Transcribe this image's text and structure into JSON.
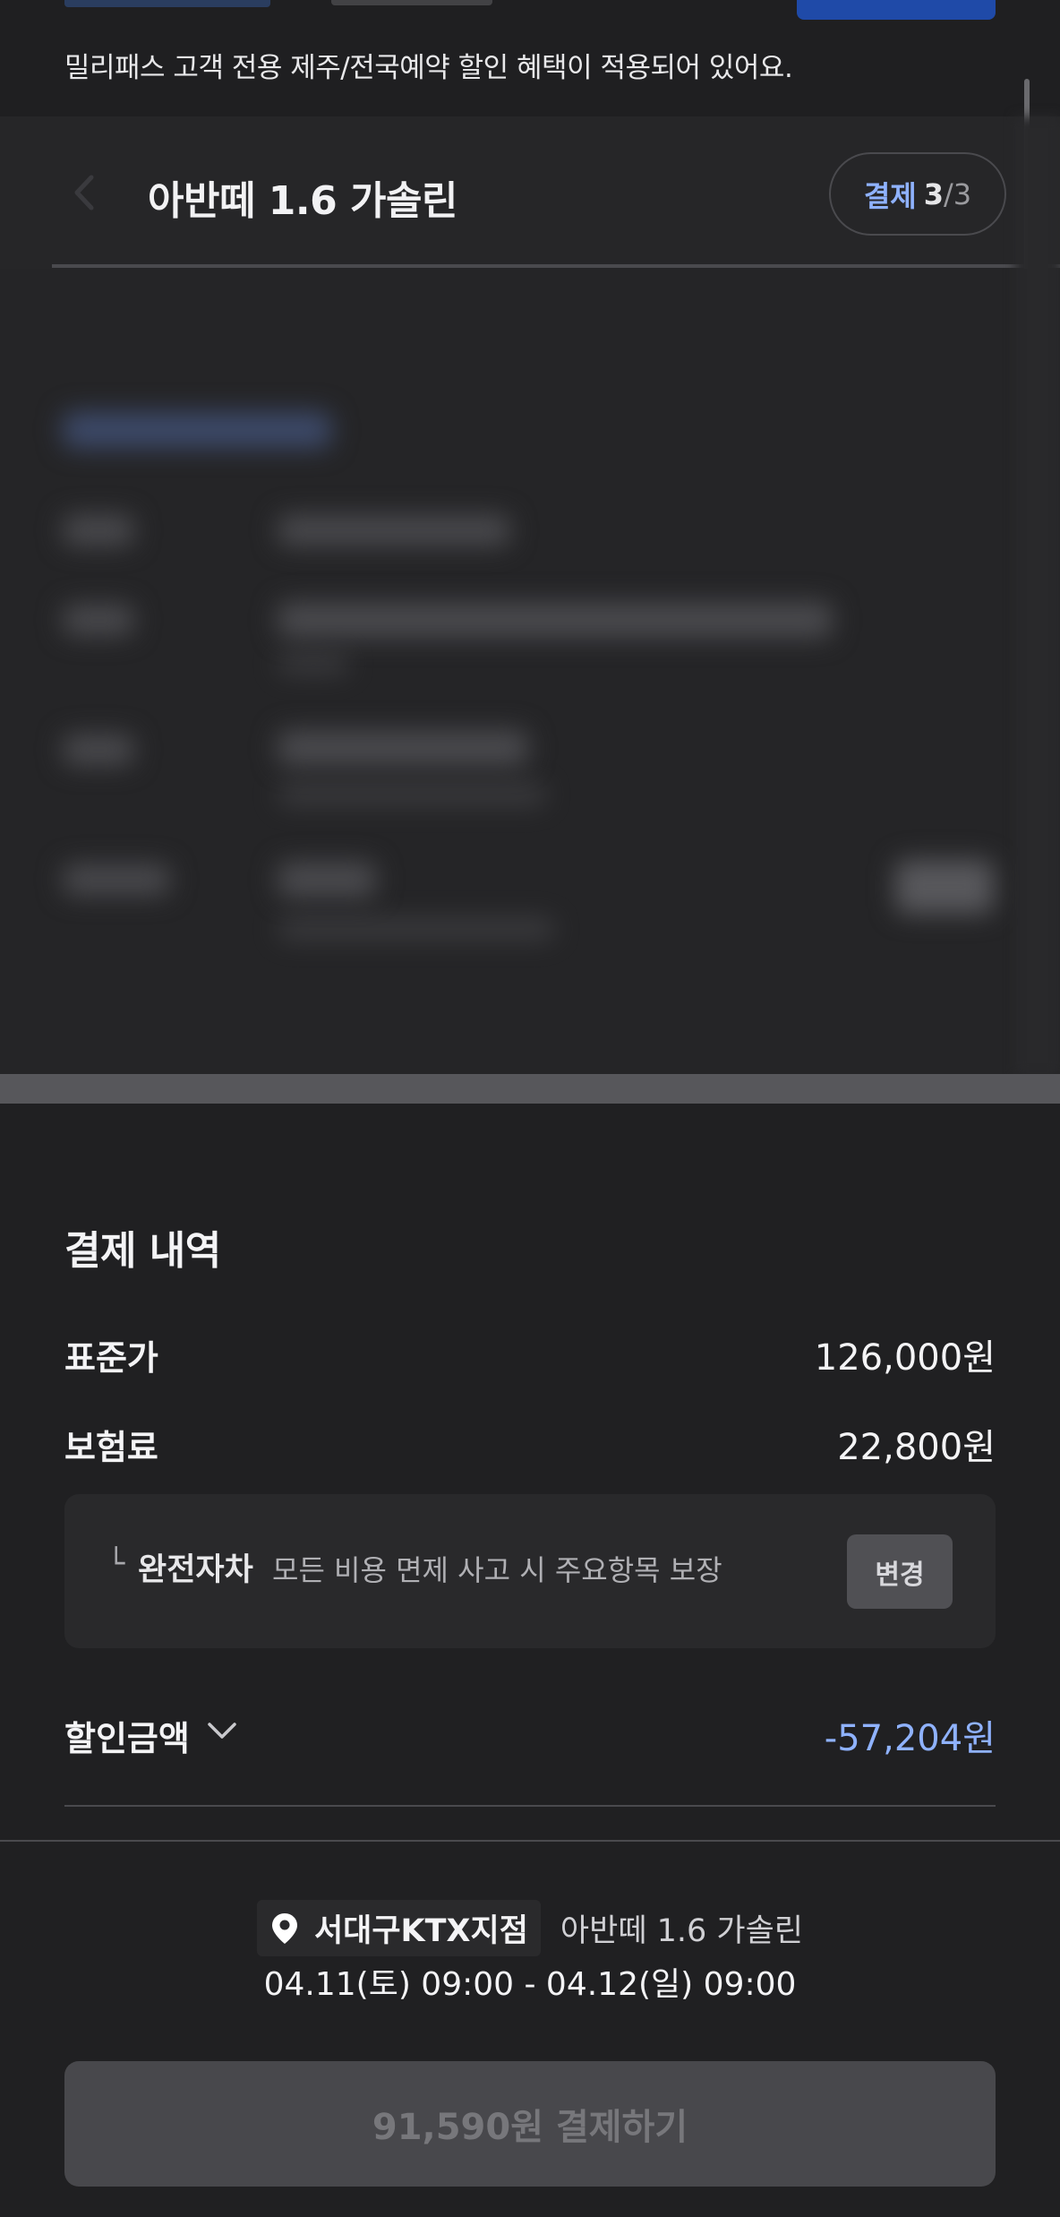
{
  "benefit_notice": "밀리패스 고객 전용 제주/전국예약 할인 혜택이 적용되어 있어요.",
  "header": {
    "title": "아반떼 1.6 가솔린",
    "step_label": "결제",
    "step_current": "3",
    "step_separator": "/",
    "step_total": "3"
  },
  "payment": {
    "section_title": "결제 내역",
    "standard_label": "표준가",
    "standard_value": "126,000원",
    "insurance_label": "보험료",
    "insurance_value": "22,800원",
    "insurance_corner": "└",
    "insurance_name": "완전자차",
    "insurance_desc": "모든 비용 면제 사고 시 주요항목 보장",
    "change_label": "변경",
    "discount_label": "할인금액",
    "discount_value": "-57,204원"
  },
  "summary": {
    "branch": "서대구KTX지점",
    "car": "아반떼 1.6 가솔린",
    "period": "04.11(토) 09:00 - 04.12(일) 09:00"
  },
  "pay_button_label": "91,590원 결제하기",
  "colors": {
    "accent": "#8fb2ff",
    "background": "#202022",
    "disabled_button": "#48484c"
  }
}
